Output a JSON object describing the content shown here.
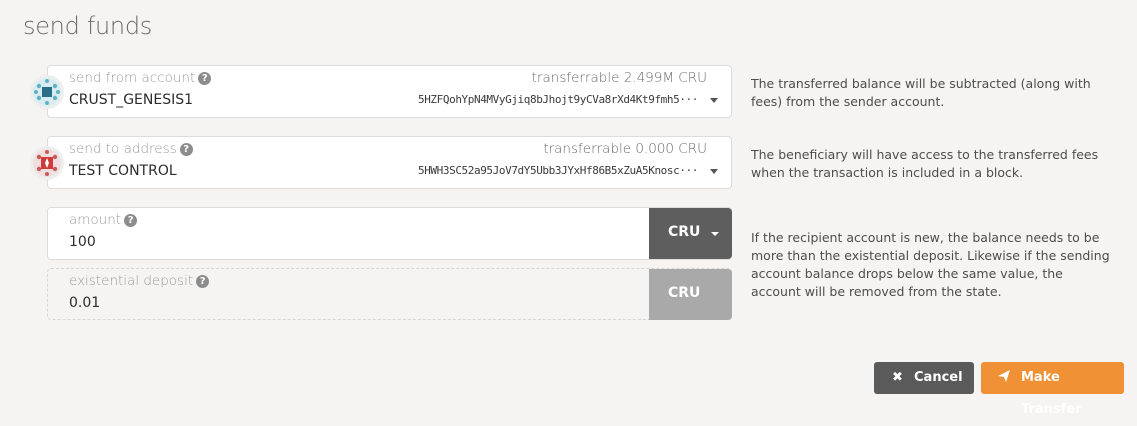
{
  "modal": {
    "title": "send funds"
  },
  "from": {
    "label": "send from account",
    "name": "CRUST_GENESIS1",
    "transferrable": "transferrable 2.499M CRU",
    "address": "5HZFQohYpN4MVyGjiq8bJhojt9yCVa8rXd4Kt9fmh5···",
    "help": "The transferred balance will be subtracted (along with fees) from the sender account."
  },
  "to": {
    "label": "send to address",
    "name": "TEST CONTROL",
    "transferrable": "transferrable 0.000 CRU",
    "address": "5HWH3SC52a95JoV7dY5Ubb3JYxHf86B5xZuA5Knosc···",
    "help": "The beneficiary will have access to the transferred fees when the transaction is included in a block."
  },
  "amount": {
    "label": "amount",
    "value": "100",
    "unit": "CRU"
  },
  "existential": {
    "label": "existential deposit",
    "value": "0.01",
    "unit": "CRU",
    "help": "If the recipient account is new, the balance needs to be more than the existential deposit. Likewise if the sending account balance drops below the same value, the account will be removed from the state."
  },
  "actions": {
    "cancel": "Cancel",
    "transfer": "Make Transfer"
  },
  "icons": {
    "help": "?",
    "cancel": "✖",
    "transfer": "paper-plane-icon"
  },
  "colors": {
    "accent": "#f19135",
    "cancel_bg": "#5a5a5a",
    "unit_dark": "#5e5e5e",
    "unit_light": "#a9a9a9"
  }
}
